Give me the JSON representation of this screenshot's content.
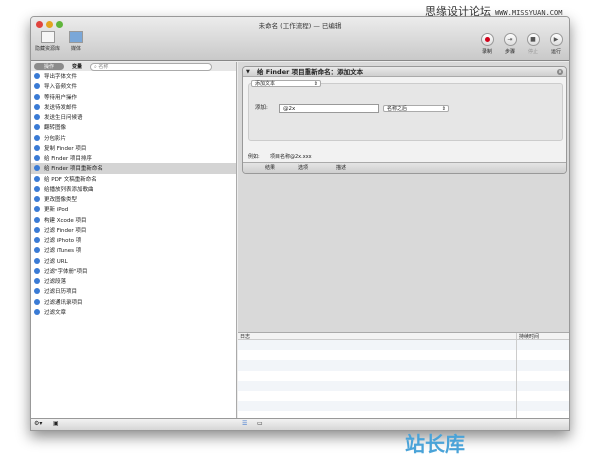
{
  "watermark_top": {
    "cn": "思缘设计论坛",
    "url": "WWW.MISSYUAN.COM"
  },
  "watermark_bottom": "站长库",
  "window": {
    "title": "未命名 (工作流程) — 已编辑"
  },
  "toolbar": {
    "left": [
      {
        "label": "隐藏资源库",
        "icon": "library-icon"
      },
      {
        "label": "媒体",
        "icon": "media-icon"
      }
    ],
    "right": [
      {
        "label": "录制",
        "icon": "record-icon"
      },
      {
        "label": "步骤",
        "icon": "step-icon"
      },
      {
        "label": "停止",
        "icon": "stop-icon"
      },
      {
        "label": "运行",
        "icon": "run-icon"
      }
    ]
  },
  "sidebar": {
    "segments": [
      "操作",
      "变量"
    ],
    "search_placeholder": "名称",
    "items": [
      "导出字体文件",
      "导入音频文件",
      "等待用户操作",
      "发送待发邮件",
      "发送生日问候语",
      "翻转图像",
      "分包影片",
      "复制 Finder 项目",
      "给 Finder 项目排序",
      "给 Finder 项目重新命名",
      "给 PDF 文稿重新命名",
      "给播放列表添加歌曲",
      "更改图像类型",
      "更新 iPod",
      "构建 Xcode 项目",
      "过滤 Finder 项目",
      "过滤 iPhoto 项",
      "过滤 iTunes 项",
      "过滤 URL",
      "过滤\"字体册\"项目",
      "过滤段落",
      "过滤日历项目",
      "过滤通讯录项目",
      "过滤文章"
    ],
    "selected_index": 9
  },
  "action": {
    "title": "给 Finder 项目重新命名：添加文本",
    "mode": "添加文本",
    "add_label": "添加:",
    "add_value": "@2x",
    "position": "名称之后",
    "example_label": "例如:",
    "example_value": "项目名称@2x.xxx",
    "tabs": [
      "结果",
      "选项",
      "描述"
    ]
  },
  "log": {
    "columns": [
      "日志",
      "持续时间"
    ]
  },
  "colors": {
    "record": "#d0021b",
    "selection": "#d4d4d4"
  }
}
